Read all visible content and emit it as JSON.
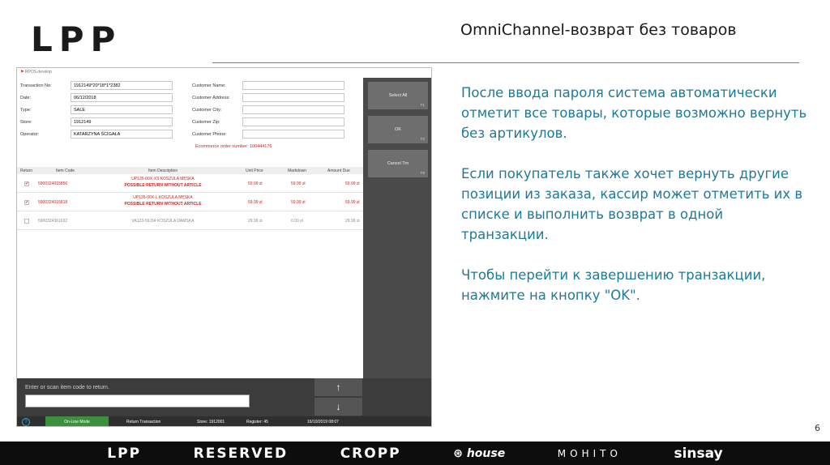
{
  "header": {
    "logo": "LPP",
    "title": "OmniChannel-возврат без товаров"
  },
  "text": {
    "p1": "После ввода пароля система автоматически отметит все товары, которые возможно вернуть без артикулов.",
    "p2": "Если покупатель также хочет вернуть другие позиции из заказа, кассир может отметить их в списке и выполнить возврат в одной транзакции.",
    "p3": "Чтобы перейти к завершению транзакции, нажмите на кнопку \"OK\"."
  },
  "page_number": "6",
  "brands": [
    "LPP",
    "RESERVED",
    "CROPP",
    "house",
    "MOHITO",
    "sinsay"
  ],
  "pos": {
    "window_title": "RPOS develop",
    "form": {
      "transaction_no_label": "Transaction No:",
      "transaction_no": "1912149*20*18*1*2382",
      "date_label": "Date:",
      "date": "06/12/2018",
      "type_label": "Type:",
      "type": "SALE",
      "store_label": "Store:",
      "store": "1912149",
      "operator_label": "Operator:",
      "operator": "KATARZYNA ŚCIGAŁA",
      "customer_name_label": "Customer Name:",
      "customer_address_label": "Customer Address:",
      "customer_city_label": "Customer City:",
      "customer_zip_label": "Customer Zip:",
      "customer_phone_label": "Customer Phone:",
      "order_number": "Ecommerce order number: 100444176"
    },
    "columns": [
      "Return",
      "Item Code",
      "Item Description",
      "Unit Price",
      "Markdown",
      "Amount Due"
    ],
    "rows": [
      {
        "checked": "✔",
        "code": "5900324015856",
        "desc": "UP135-00X-XS KOSZULA MĘSKA",
        "note": "POSSIBLE RETURN WITHOUT ARTICLE",
        "price": "59.99 zł",
        "markdown": "59.99 zł",
        "amount": "59.99 zł"
      },
      {
        "checked": "✔",
        "code": "5900324015818",
        "desc": "UP135-00X-L KOSZULA MĘSKA",
        "note": "POSSIBLE RETURN WITHOUT ARTICLE",
        "price": "59.99 zł",
        "markdown": "59.99 zł",
        "amount": "59.99 zł"
      },
      {
        "checked": "",
        "code": "5900324361632",
        "desc": "VA123-59J34 KOSZULA DAMSKA",
        "note": "",
        "price": "29.99 zł",
        "markdown": "0.00 zł",
        "amount": "29.99 zł"
      }
    ],
    "side_buttons": [
      {
        "label": "Select All",
        "key": "F1"
      },
      {
        "label": "OK",
        "key": "F2"
      },
      {
        "label": "Cancel Trn",
        "key": "F8"
      }
    ],
    "scan_label": "Enter or scan item code to return.",
    "scan_value": "",
    "arrow_up": "↑",
    "arrow_down": "↓",
    "status": {
      "help": "?",
      "mode": "On-Line Mode",
      "transaction": "Return Transaction",
      "store": "Store: 1912001",
      "register": "Register: 45",
      "datetime": "16/10/2019 08:07"
    }
  }
}
